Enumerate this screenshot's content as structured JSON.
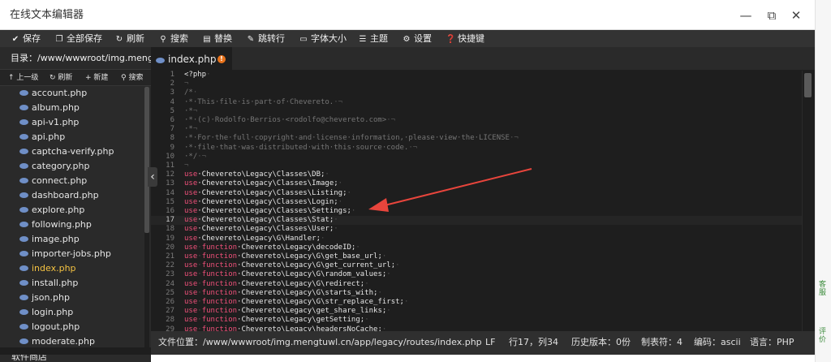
{
  "window": {
    "title": "在线文本编辑器",
    "min_glyph": "—",
    "max_glyph": "⧉",
    "close_glyph": "✕"
  },
  "toolbar": {
    "save": "保存",
    "save_all": "全部保存",
    "refresh": "刷新",
    "search": "搜索",
    "replace": "替换",
    "goto": "跳转行",
    "font_size": "字体大小",
    "theme": "主题",
    "settings": "设置",
    "shortcuts": "快捷键"
  },
  "sidebar": {
    "path": "目录：/www/wwwroot/img.meng...",
    "actions": {
      "up": "上一级",
      "refresh": "刷新",
      "new": "新建",
      "search": "搜索"
    },
    "files": [
      "account.php",
      "album.php",
      "api-v1.php",
      "api.php",
      "captcha-verify.php",
      "category.php",
      "connect.php",
      "dashboard.php",
      "explore.php",
      "following.php",
      "image.php",
      "importer-jobs.php",
      "index.php",
      "install.php",
      "json.php",
      "login.php",
      "logout.php",
      "moderate.php"
    ],
    "active_file": "index.php"
  },
  "editor": {
    "tab_name": "index.php",
    "tab_badge": "!",
    "collapse_glyph": "‹",
    "current_line": 17,
    "lines": [
      {
        "n": "1",
        "parts": [
          {
            "t": "<?php",
            "c": "tx"
          },
          {
            "t": "·",
            "c": "ws"
          }
        ]
      },
      {
        "n": "2",
        "parts": [
          {
            "t": "¬",
            "c": "ws"
          }
        ]
      },
      {
        "n": "3",
        "parts": [
          {
            "t": "/*",
            "c": "cm"
          },
          {
            "t": "·",
            "c": "ws"
          }
        ]
      },
      {
        "n": "4",
        "parts": [
          {
            "t": "·*·This·file·is·part·of·Chevereto.",
            "c": "cm"
          },
          {
            "t": "·¬",
            "c": "ws"
          }
        ]
      },
      {
        "n": "5",
        "parts": [
          {
            "t": "·*",
            "c": "cm"
          },
          {
            "t": "¬",
            "c": "ws"
          }
        ]
      },
      {
        "n": "6",
        "parts": [
          {
            "t": "·*·(c)·Rodolfo·Berrios·<rodolfo@chevereto.com>",
            "c": "cm"
          },
          {
            "t": "·¬",
            "c": "ws"
          }
        ]
      },
      {
        "n": "7",
        "parts": [
          {
            "t": "·*",
            "c": "cm"
          },
          {
            "t": "¬",
            "c": "ws"
          }
        ]
      },
      {
        "n": "8",
        "parts": [
          {
            "t": "·*·For·the·full·copyright·and·license·information,·please·view·the·LICENSE",
            "c": "cm"
          },
          {
            "t": "·¬",
            "c": "ws"
          }
        ]
      },
      {
        "n": "9",
        "parts": [
          {
            "t": "·*·file·that·was·distributed·with·this·source·code.",
            "c": "cm"
          },
          {
            "t": "·¬",
            "c": "ws"
          }
        ]
      },
      {
        "n": "10",
        "parts": [
          {
            "t": "·*/",
            "c": "cm"
          },
          {
            "t": "·¬",
            "c": "ws"
          }
        ]
      },
      {
        "n": "11",
        "parts": [
          {
            "t": "¬",
            "c": "ws"
          }
        ]
      },
      {
        "n": "12",
        "parts": [
          {
            "t": "use",
            "c": "kw"
          },
          {
            "t": "·Chevereto\\Legacy\\Classes\\DB;",
            "c": "tx"
          },
          {
            "t": "·",
            "c": "ws"
          }
        ]
      },
      {
        "n": "13",
        "parts": [
          {
            "t": "use",
            "c": "kw"
          },
          {
            "t": "·Chevereto\\Legacy\\Classes\\Image;",
            "c": "tx"
          },
          {
            "t": "·",
            "c": "ws"
          }
        ]
      },
      {
        "n": "14",
        "parts": [
          {
            "t": "use",
            "c": "kw"
          },
          {
            "t": "·Chevereto\\Legacy\\Classes\\Listing;",
            "c": "tx"
          },
          {
            "t": "·",
            "c": "ws"
          }
        ]
      },
      {
        "n": "15",
        "parts": [
          {
            "t": "use",
            "c": "kw"
          },
          {
            "t": "·Chevereto\\Legacy\\Classes\\Login;",
            "c": "tx"
          },
          {
            "t": "·",
            "c": "ws"
          }
        ]
      },
      {
        "n": "16",
        "parts": [
          {
            "t": "use",
            "c": "kw"
          },
          {
            "t": "·Chevereto\\Legacy\\Classes\\Settings;",
            "c": "tx"
          },
          {
            "t": "·",
            "c": "ws"
          }
        ]
      },
      {
        "n": "17",
        "parts": [
          {
            "t": "use",
            "c": "kw"
          },
          {
            "t": "·Chevereto\\Legacy\\Classes\\Stat;",
            "c": "tx"
          },
          {
            "t": "·",
            "c": "ws"
          }
        ]
      },
      {
        "n": "18",
        "parts": [
          {
            "t": "use",
            "c": "kw"
          },
          {
            "t": "·Chevereto\\Legacy\\Classes\\User;",
            "c": "tx"
          },
          {
            "t": "·",
            "c": "ws"
          }
        ]
      },
      {
        "n": "19",
        "parts": [
          {
            "t": "use",
            "c": "kw"
          },
          {
            "t": "·Chevereto\\Legacy\\G\\Handler;",
            "c": "tx"
          },
          {
            "t": "·",
            "c": "ws"
          }
        ]
      },
      {
        "n": "20",
        "parts": [
          {
            "t": "use",
            "c": "kw"
          },
          {
            "t": "·",
            "c": "ws"
          },
          {
            "t": "function",
            "c": "kw"
          },
          {
            "t": "·Chevereto\\Legacy\\decodeID;",
            "c": "tx"
          },
          {
            "t": "·",
            "c": "ws"
          }
        ]
      },
      {
        "n": "21",
        "parts": [
          {
            "t": "use",
            "c": "kw"
          },
          {
            "t": "·",
            "c": "ws"
          },
          {
            "t": "function",
            "c": "kw"
          },
          {
            "t": "·Chevereto\\Legacy\\G\\get_base_url;",
            "c": "tx"
          },
          {
            "t": "·",
            "c": "ws"
          }
        ]
      },
      {
        "n": "22",
        "parts": [
          {
            "t": "use",
            "c": "kw"
          },
          {
            "t": "·",
            "c": "ws"
          },
          {
            "t": "function",
            "c": "kw"
          },
          {
            "t": "·Chevereto\\Legacy\\G\\get_current_url;",
            "c": "tx"
          },
          {
            "t": "·",
            "c": "ws"
          }
        ]
      },
      {
        "n": "23",
        "parts": [
          {
            "t": "use",
            "c": "kw"
          },
          {
            "t": "·",
            "c": "ws"
          },
          {
            "t": "function",
            "c": "kw"
          },
          {
            "t": "·Chevereto\\Legacy\\G\\random_values;",
            "c": "tx"
          },
          {
            "t": "·",
            "c": "ws"
          }
        ]
      },
      {
        "n": "24",
        "parts": [
          {
            "t": "use",
            "c": "kw"
          },
          {
            "t": "·",
            "c": "ws"
          },
          {
            "t": "function",
            "c": "kw"
          },
          {
            "t": "·Chevereto\\Legacy\\G\\redirect;",
            "c": "tx"
          },
          {
            "t": "·",
            "c": "ws"
          }
        ]
      },
      {
        "n": "25",
        "parts": [
          {
            "t": "use",
            "c": "kw"
          },
          {
            "t": "·",
            "c": "ws"
          },
          {
            "t": "function",
            "c": "kw"
          },
          {
            "t": "·Chevereto\\Legacy\\G\\starts_with;",
            "c": "tx"
          },
          {
            "t": "·",
            "c": "ws"
          }
        ]
      },
      {
        "n": "26",
        "parts": [
          {
            "t": "use",
            "c": "kw"
          },
          {
            "t": "·",
            "c": "ws"
          },
          {
            "t": "function",
            "c": "kw"
          },
          {
            "t": "·Chevereto\\Legacy\\G\\str_replace_first;",
            "c": "tx"
          },
          {
            "t": "·",
            "c": "ws"
          }
        ]
      },
      {
        "n": "27",
        "parts": [
          {
            "t": "use",
            "c": "kw"
          },
          {
            "t": "·",
            "c": "ws"
          },
          {
            "t": "function",
            "c": "kw"
          },
          {
            "t": "·Chevereto\\Legacy\\get_share_links;",
            "c": "tx"
          },
          {
            "t": "·",
            "c": "ws"
          }
        ]
      },
      {
        "n": "28",
        "parts": [
          {
            "t": "use",
            "c": "kw"
          },
          {
            "t": "·",
            "c": "ws"
          },
          {
            "t": "function",
            "c": "kw"
          },
          {
            "t": "·Chevereto\\Legacy\\getSetting;",
            "c": "tx"
          },
          {
            "t": "·",
            "c": "ws"
          }
        ]
      },
      {
        "n": "29",
        "parts": [
          {
            "t": "use",
            "c": "kw"
          },
          {
            "t": "·",
            "c": "ws"
          },
          {
            "t": "function",
            "c": "kw"
          },
          {
            "t": "·Chevereto\\Legacy\\headersNoCache;",
            "c": "tx"
          },
          {
            "t": "·",
            "c": "ws"
          }
        ]
      }
    ]
  },
  "status": {
    "file_path": "文件位置：/www/wwwroot/img.mengtuwl.cn/app/legacy/routes/index.php",
    "line_ending": "LF",
    "cursor": "行17，列34",
    "history": "历史版本：0份",
    "tab_size": "制表符：4",
    "encoding": "编码：ascii",
    "language": "语言：PHP"
  },
  "background": {
    "bottom_left_label": "软件商店",
    "right_edge_text_1": "客服",
    "right_edge_text_2": "评价"
  },
  "colors": {
    "keyword": "#f0507a",
    "comment": "#757575",
    "active_file": "#f5c342",
    "tab_badge": "#e8731c",
    "annotation_arrow": "#e8453c"
  }
}
